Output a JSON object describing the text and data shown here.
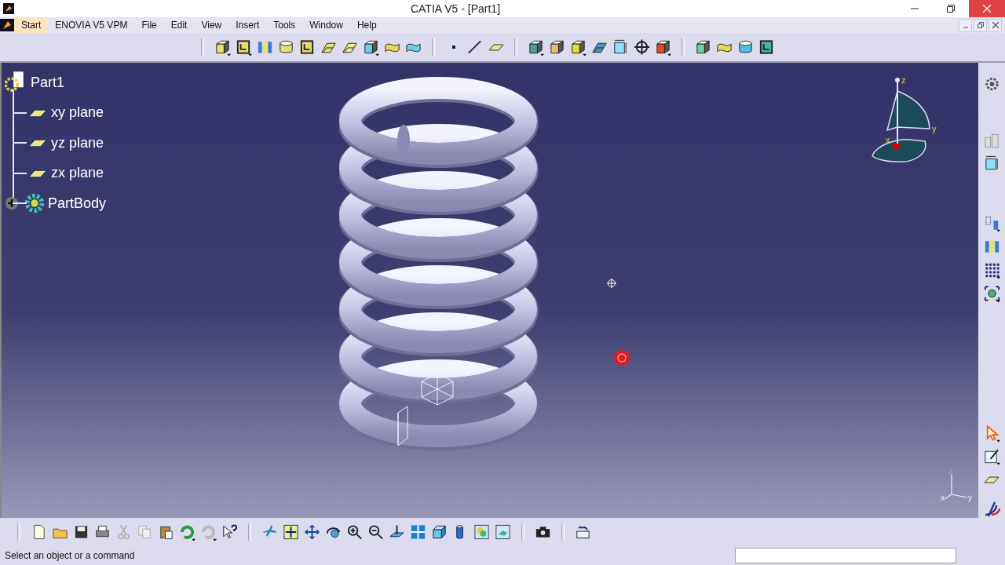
{
  "window": {
    "title": "CATIA V5 - [Part1]"
  },
  "menu": [
    {
      "label": "Start",
      "selected": true
    },
    {
      "label": "ENOVIA V5 VPM",
      "selected": false
    },
    {
      "label": "File",
      "selected": false
    },
    {
      "label": "Edit",
      "selected": false
    },
    {
      "label": "View",
      "selected": false
    },
    {
      "label": "Insert",
      "selected": false
    },
    {
      "label": "Tools",
      "selected": false
    },
    {
      "label": "Window",
      "selected": false
    },
    {
      "label": "Help",
      "selected": false
    }
  ],
  "tree": {
    "label": "Part1",
    "children": [
      {
        "label": "xy plane",
        "kind": "plane"
      },
      {
        "label": "yz plane",
        "kind": "plane"
      },
      {
        "label": "zx plane",
        "kind": "plane"
      },
      {
        "label": "PartBody",
        "kind": "body",
        "expanded": false
      }
    ]
  },
  "compass": {
    "axis_labels": [
      "z",
      "y",
      "x"
    ]
  },
  "axis_triad": {
    "axis_labels": [
      "z",
      "x",
      "y"
    ]
  },
  "status_bar": {
    "message": "Select an object or a command"
  }
}
